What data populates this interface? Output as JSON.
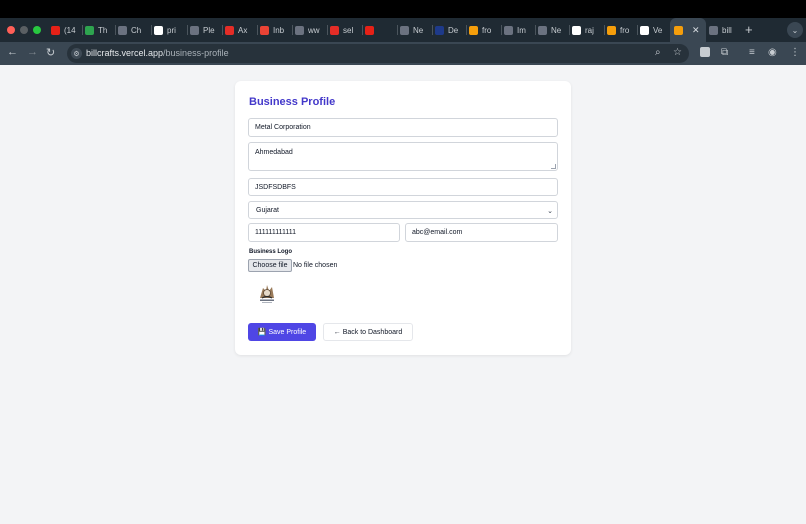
{
  "browser": {
    "tabs": [
      {
        "label": "(14",
        "icon": "youtube-icon",
        "color": "#e62117"
      },
      {
        "label": "Th",
        "icon": "green-plus-icon",
        "color": "#2ea44f"
      },
      {
        "label": "Ch",
        "icon": "openai-icon",
        "color": "#6b7280"
      },
      {
        "label": "pri",
        "icon": "google-icon",
        "color": "#ffffff"
      },
      {
        "label": "Ple",
        "icon": "globe-icon",
        "color": "#6b7280"
      },
      {
        "label": "Ax",
        "icon": "acrobat-icon",
        "color": "#e52d27"
      },
      {
        "label": "Inb",
        "icon": "gmail-icon",
        "color": "#ea4335"
      },
      {
        "label": "ww",
        "icon": "globe-icon",
        "color": "#6b7280"
      },
      {
        "label": "sel",
        "icon": "acrobat-icon",
        "color": "#e52d27"
      },
      {
        "label": "",
        "icon": "youtube-icon",
        "color": "#e62117"
      },
      {
        "label": "Ne",
        "icon": "globe-icon",
        "color": "#6b7280"
      },
      {
        "label": "De",
        "icon": "d-icon",
        "color": "#1e3a8a"
      },
      {
        "label": "fro",
        "icon": "vue-icon",
        "color": "#f59e0b"
      },
      {
        "label": "Im",
        "icon": "openai-icon",
        "color": "#6b7280"
      },
      {
        "label": "Ne",
        "icon": "globe-icon",
        "color": "#6b7280"
      },
      {
        "label": "raj",
        "icon": "github-icon",
        "color": "#ffffff"
      },
      {
        "label": "fro",
        "icon": "vue-icon",
        "color": "#f59e0b"
      },
      {
        "label": "Ve",
        "icon": "vercel-icon",
        "color": "#ffffff"
      },
      {
        "label": "",
        "icon": "vue-icon",
        "color": "#f59e0b",
        "active": true
      },
      {
        "label": "bill",
        "icon": "globe-icon",
        "color": "#6b7280"
      }
    ],
    "url_host": "billcrafts.vercel.app",
    "url_path": "/business-profile"
  },
  "page": {
    "title": "Business Profile",
    "business_name": "Metal Corporation",
    "address": "Ahmedabad",
    "gst_number": "JSDFSDBFS",
    "state": "Gujarat",
    "phone": "111111111111",
    "email": "abc@email.com",
    "logo_label": "Business Logo",
    "choose_file_label": "Choose file",
    "no_file_text": "No file chosen",
    "save_label": "💾 Save Profile",
    "back_label": "← Back to Dashboard"
  }
}
